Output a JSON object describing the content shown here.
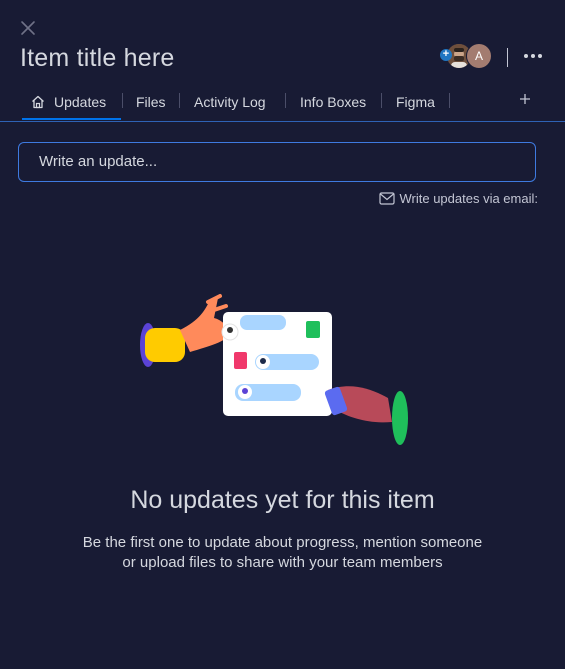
{
  "header": {
    "title": "Item title here",
    "avatar_initial": "A"
  },
  "tabs": [
    {
      "label": "Updates",
      "active": true
    },
    {
      "label": "Files"
    },
    {
      "label": "Activity Log"
    },
    {
      "label": "Info Boxes"
    },
    {
      "label": "Figma"
    }
  ],
  "update_input": {
    "placeholder": "Write an update..."
  },
  "email_link": {
    "label": "Write updates via email:"
  },
  "empty_state": {
    "title": "No updates yet for this item",
    "line1": "Be the first one to update about progress, mention someone",
    "line2": "or upload files to share with your team members"
  },
  "icons": {
    "close": "close-icon",
    "home": "home-icon",
    "more": "more-horizontal-icon",
    "add": "plus-icon",
    "mail": "mail-icon"
  },
  "colors": {
    "background": "#181b34",
    "accent": "#0073ea",
    "text": "#d5d8df"
  }
}
